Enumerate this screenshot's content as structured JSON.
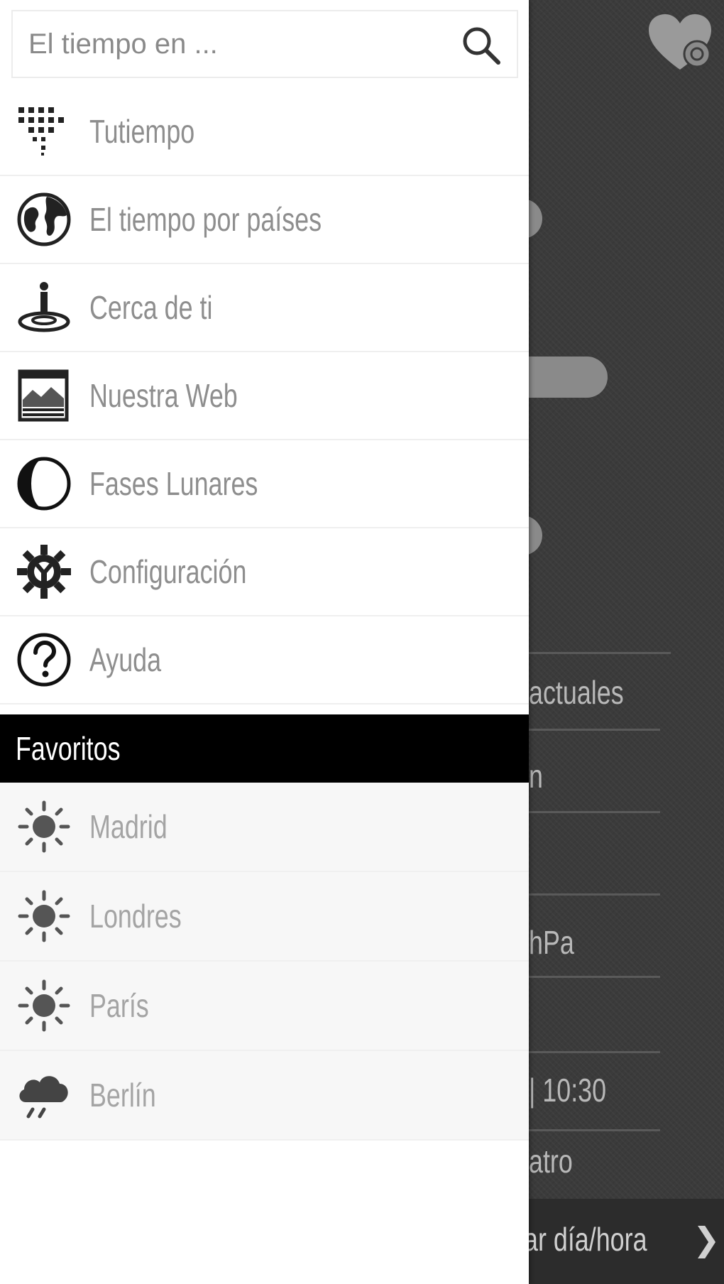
{
  "search": {
    "placeholder": "El tiempo en ..."
  },
  "menu": {
    "items": [
      {
        "label": "Tutiempo",
        "icon": "dots-grid-icon"
      },
      {
        "label": "El tiempo por países",
        "icon": "globe-icon"
      },
      {
        "label": "Cerca de ti",
        "icon": "location-person-icon"
      },
      {
        "label": "Nuestra Web",
        "icon": "web-page-icon"
      },
      {
        "label": "Fases Lunares",
        "icon": "moon-phase-icon"
      },
      {
        "label": "Configuración",
        "icon": "gear-icon"
      },
      {
        "label": "Ayuda",
        "icon": "help-icon"
      }
    ]
  },
  "favorites": {
    "title": "Favoritos",
    "items": [
      {
        "label": "Madrid",
        "icon": "sun-icon"
      },
      {
        "label": "Londres",
        "icon": "sun-icon"
      },
      {
        "label": "París",
        "icon": "sun-icon"
      },
      {
        "label": "Berlín",
        "icon": "rain-cloud-icon"
      }
    ]
  },
  "background": {
    "texts": [
      "actuales",
      "n",
      "hPa",
      "| 10:30",
      "atro",
      "ar día/hora",
      "❯"
    ]
  },
  "colors": {
    "drawer_bg": "#ffffff",
    "favorites_header_bg": "#000000",
    "menu_text": "#8e8e8e",
    "background_app": "#3b3b3b"
  }
}
